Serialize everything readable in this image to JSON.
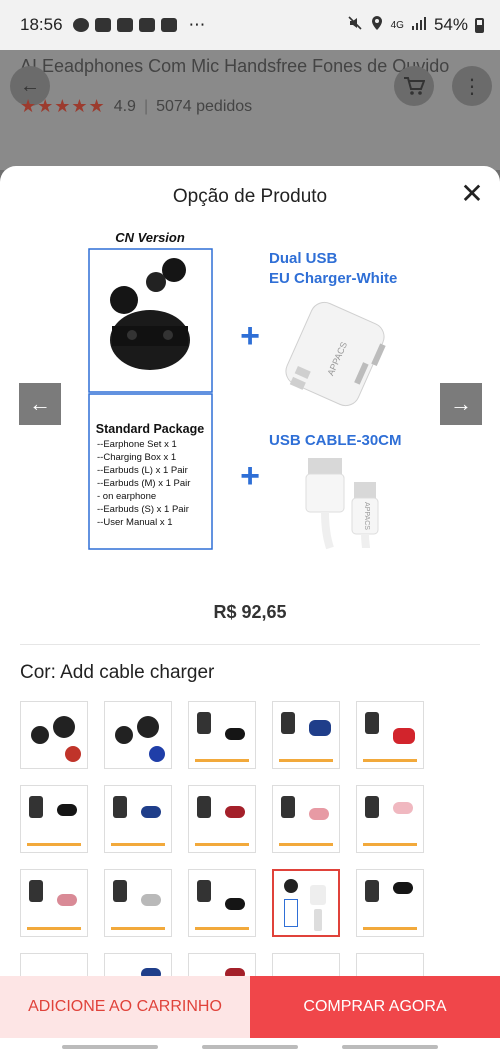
{
  "status_bar": {
    "time": "18:56",
    "ellipsis": "⋯",
    "network": "4G",
    "battery": "54%"
  },
  "background_page": {
    "title": "AI Eeadphones Com Mic Handsfree Fones de Ouvido",
    "rating": "4.9",
    "orders": "5074 pedidos"
  },
  "sheet": {
    "title": "Opção de Produto",
    "close_glyph": "✕"
  },
  "hero": {
    "cn_version": "CN Version",
    "charger_title_line1": "Dual USB",
    "charger_title_line2": "EU Charger-White",
    "cable_title": "USB CABLE-30CM",
    "charger_brand": "APPACS",
    "cable_brand": "APPACS",
    "package_title": "Standard Package",
    "package_items": [
      "--Earphone Set   x 1",
      "--Charging Box   x 1",
      "--Earbuds (L) x 1 Pair",
      "--Earbuds (M) x 1 Pair",
      "  - on earphone",
      "--Earbuds (S) x 1 Pair",
      "--User Manual x 1"
    ]
  },
  "price": "R$ 92,65",
  "option": {
    "label": "Cor: Add cable charger"
  },
  "buttons": {
    "prev_glyph": "←",
    "next_glyph": "→",
    "add_to_cart": "ADICIONE AO CARRINHO",
    "buy_now": "COMPRAR AGORA"
  },
  "colors": {
    "accent": "#f0464a",
    "accent_light": "#fde5e5",
    "selected_border": "#e0423a",
    "hero_blue": "#2f6fd6"
  }
}
